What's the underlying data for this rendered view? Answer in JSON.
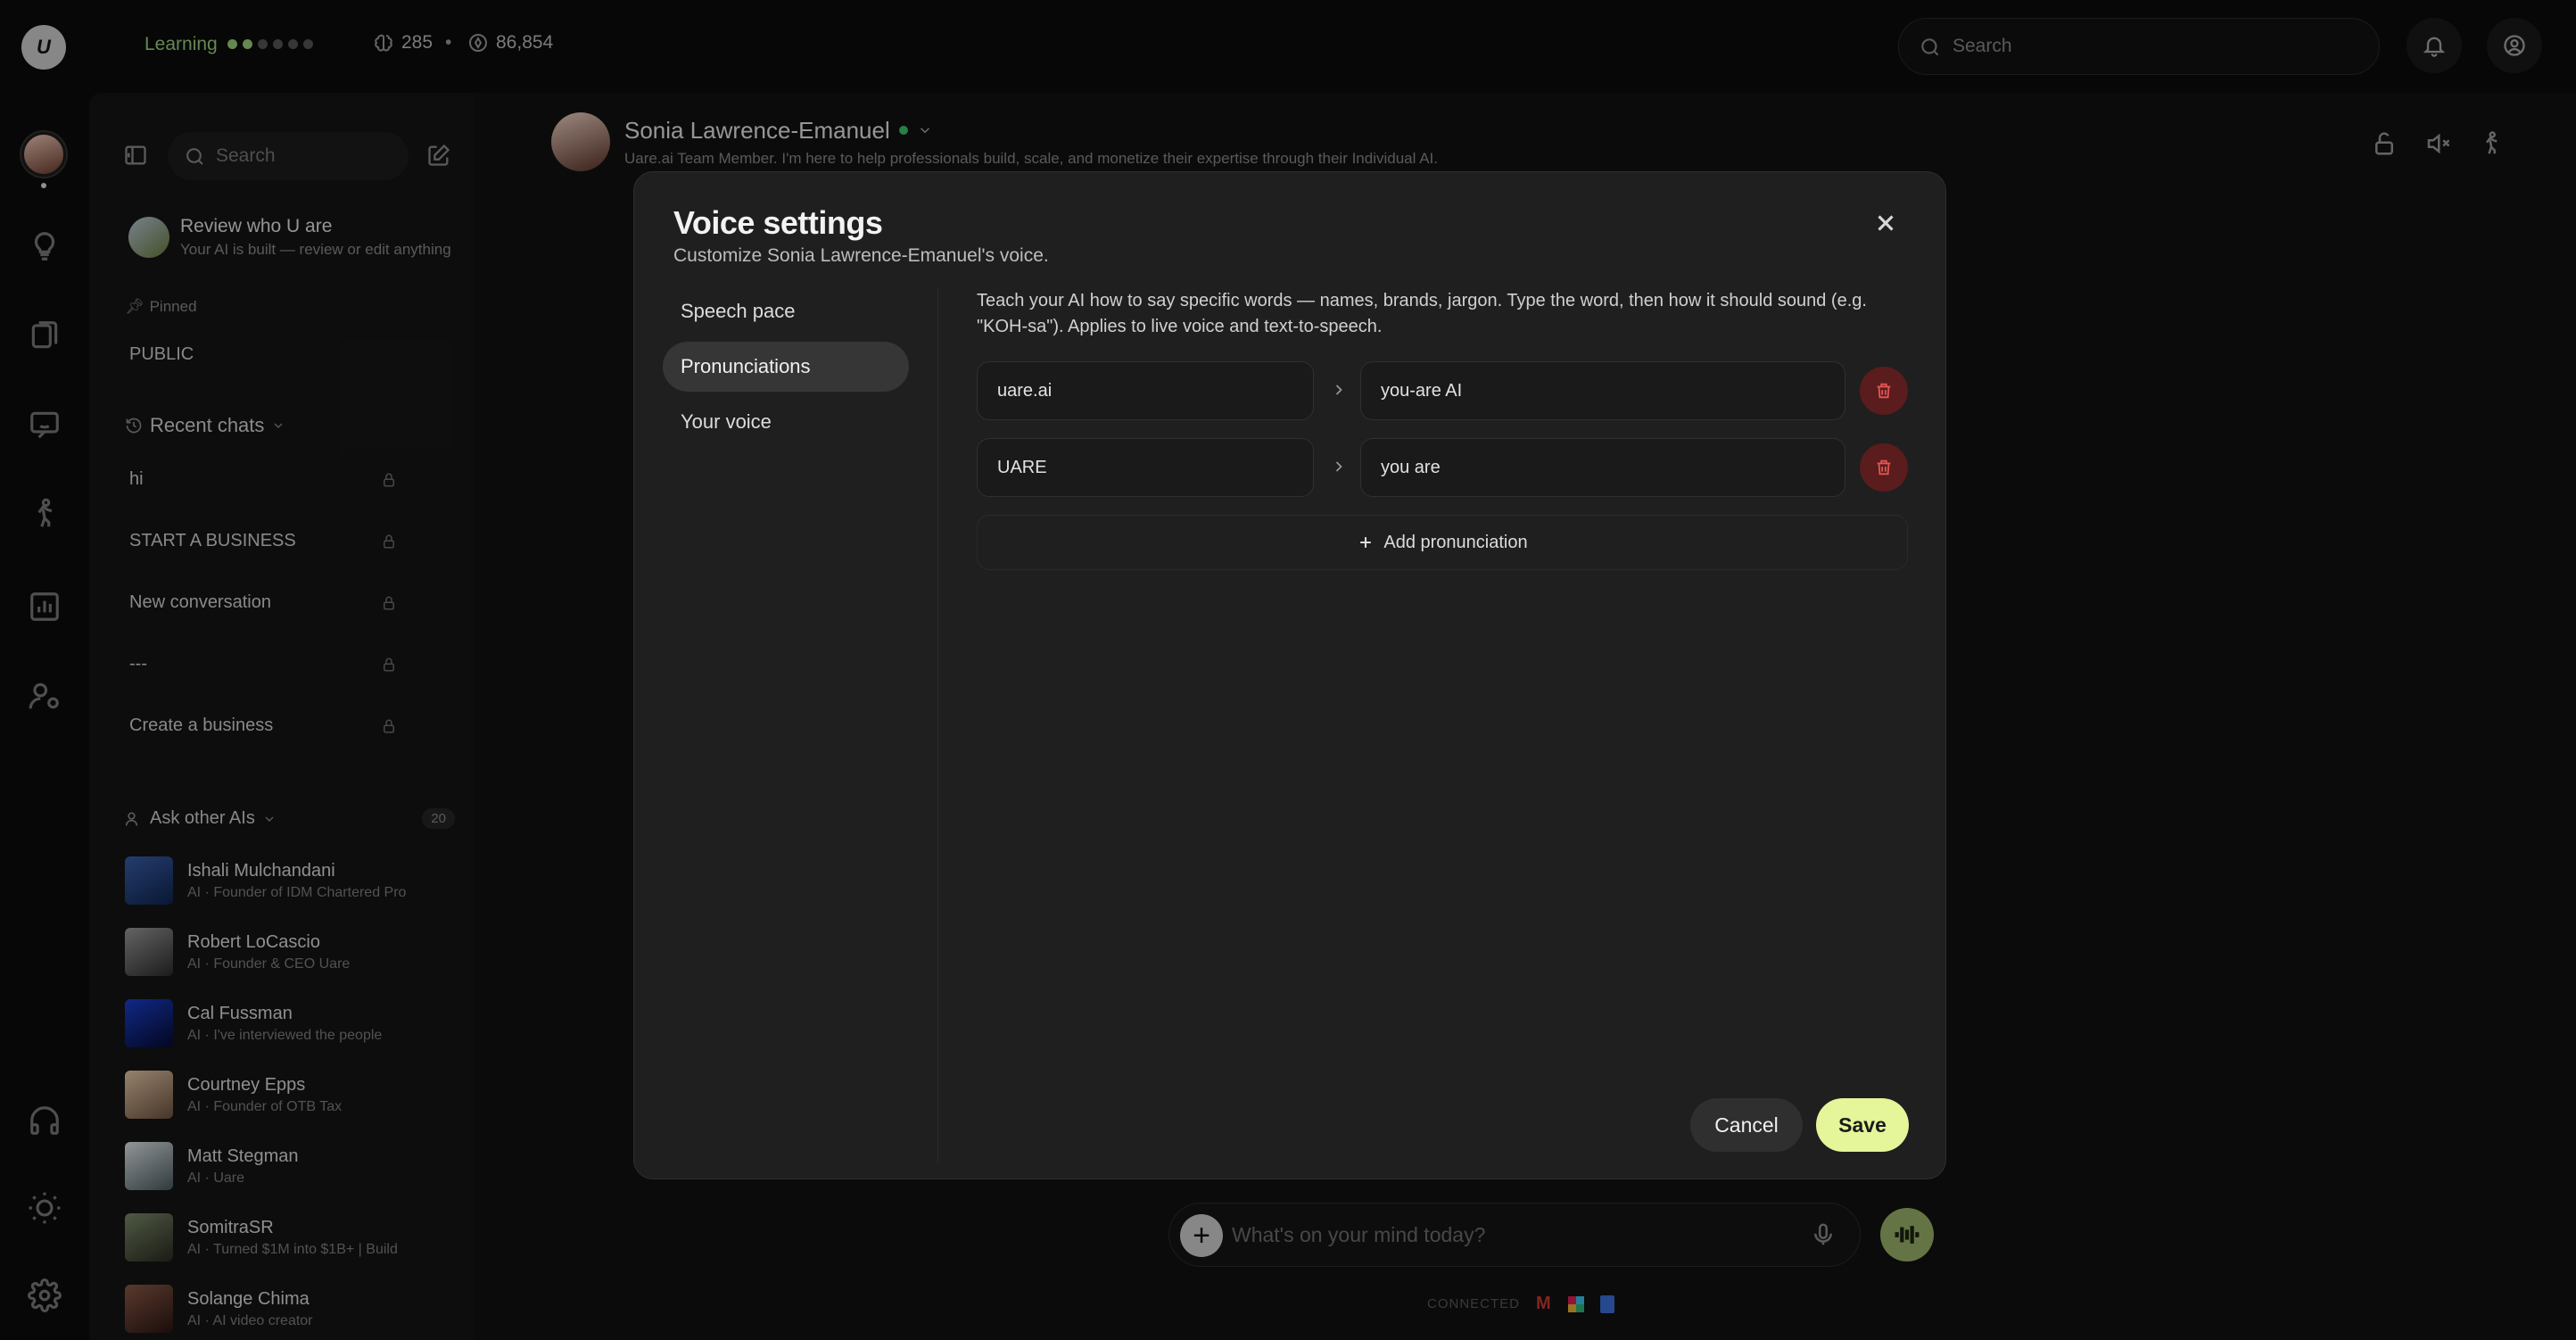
{
  "topbar": {
    "learning_label": "Learning",
    "learning_dots_filled": 2,
    "learning_dots_total": 6,
    "stat1": "285",
    "stat2": "86,854",
    "search_placeholder": "Search"
  },
  "sidebar": {
    "search_placeholder": "Search",
    "review_title": "Review who U are",
    "review_sub": "Your AI is built — review or edit anything",
    "pinned_label": "Pinned",
    "pinned_item": "PUBLIC",
    "recent_label": "Recent chats",
    "chats": [
      "hi",
      "START A BUSINESS",
      "New conversation",
      "---",
      "Create a business"
    ],
    "ask_label": "Ask other AIs",
    "ask_count": "20",
    "people": [
      {
        "name": "Ishali Mulchandani",
        "sub": "AI · Founder of IDM Chartered Pro"
      },
      {
        "name": "Robert LoCascio",
        "sub": "AI · Founder & CEO Uare"
      },
      {
        "name": "Cal Fussman",
        "sub": "AI · I've interviewed the people"
      },
      {
        "name": "Courtney Epps",
        "sub": "AI · Founder of OTB Tax"
      },
      {
        "name": "Matt Stegman",
        "sub": "AI · Uare"
      },
      {
        "name": "SomitraSR",
        "sub": "AI · Turned $1M into $1B+ | Build"
      },
      {
        "name": "Solange Chima",
        "sub": "AI · AI video creator"
      }
    ]
  },
  "agent": {
    "name": "Sonia Lawrence-Emanuel",
    "desc": "Uare.ai Team Member. I'm here to help professionals build, scale, and monetize their expertise through their Individual AI."
  },
  "composer": {
    "placeholder": "What's on your mind today?",
    "connected_label": "CONNECTED"
  },
  "modal": {
    "title": "Voice settings",
    "subtitle": "Customize Sonia Lawrence-Emanuel's voice.",
    "nav": [
      "Speech pace",
      "Pronunciations",
      "Your voice"
    ],
    "active_nav": "Pronunciations",
    "hint": "Teach your AI how to say specific words — names, brands, jargon. Type the word, then how it should sound (e.g. \"KOH-sa\"). Applies to live voice and text-to-speech.",
    "rows": [
      {
        "word": "uare.ai",
        "sound": "you-are AI"
      },
      {
        "word": "UARE",
        "sound": "you are"
      }
    ],
    "add_label": "Add pronunciation",
    "cancel_label": "Cancel",
    "save_label": "Save"
  },
  "colors": {
    "accent": "#e4f59a",
    "learning": "#9bd17c",
    "danger": "#e25555",
    "online": "#3ec46d"
  }
}
